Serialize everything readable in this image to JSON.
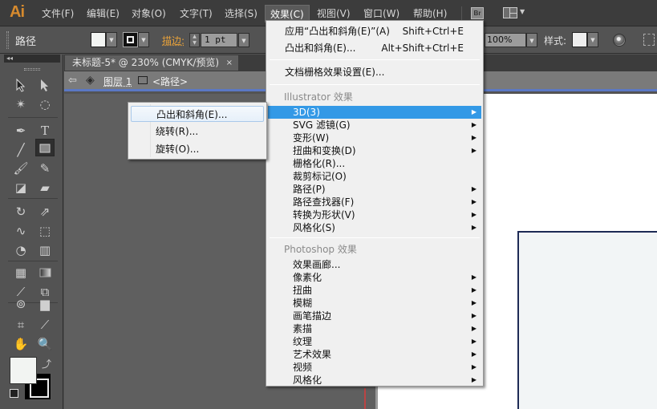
{
  "app": {
    "logo": "Ai"
  },
  "menubar": {
    "items": [
      "文件(F)",
      "编辑(E)",
      "对象(O)",
      "文字(T)",
      "选择(S)",
      "效果(C)",
      "视图(V)",
      "窗口(W)",
      "帮助(H)"
    ],
    "open_item": "效果(C)",
    "bridge_label": "Br"
  },
  "controlbar": {
    "selection_label": "路径",
    "stroke_label": "描边:",
    "stroke_weight": "1 pt",
    "opacity": "100%",
    "style_label": "样式:"
  },
  "document": {
    "tab_title": "未标题-5* @ 230% (CMYK/预览)",
    "tab_close": "×",
    "breadcrumb_layer": "图层 1",
    "breadcrumb_path": "<路径>"
  },
  "effect_menu": {
    "apply_last": {
      "label": "应用“凸出和斜角(E)”(A)",
      "shortcut": "Shift+Ctrl+E"
    },
    "last_effect": {
      "label": "凸出和斜角(E)...",
      "shortcut": "Alt+Shift+Ctrl+E"
    },
    "raster_settings": "文档栅格效果设置(E)...",
    "illustrator_header": "Illustrator 效果",
    "illustrator_items": [
      {
        "label": "3D(3)",
        "submenu": true,
        "highlighted": true
      },
      {
        "label": "SVG 滤镜(G)",
        "submenu": true
      },
      {
        "label": "变形(W)",
        "submenu": true
      },
      {
        "label": "扭曲和变换(D)",
        "submenu": true
      },
      {
        "label": "栅格化(R)...",
        "submenu": false
      },
      {
        "label": "裁剪标记(O)",
        "submenu": false
      },
      {
        "label": "路径(P)",
        "submenu": true
      },
      {
        "label": "路径查找器(F)",
        "submenu": true
      },
      {
        "label": "转换为形状(V)",
        "submenu": true
      },
      {
        "label": "风格化(S)",
        "submenu": true
      }
    ],
    "photoshop_header": "Photoshop 效果",
    "photoshop_items": [
      {
        "label": "效果画廊...",
        "submenu": false
      },
      {
        "label": "像素化",
        "submenu": true
      },
      {
        "label": "扭曲",
        "submenu": true
      },
      {
        "label": "模糊",
        "submenu": true
      },
      {
        "label": "画笔描边",
        "submenu": true
      },
      {
        "label": "素描",
        "submenu": true
      },
      {
        "label": "纹理",
        "submenu": true
      },
      {
        "label": "艺术效果",
        "submenu": true
      },
      {
        "label": "视频",
        "submenu": true
      },
      {
        "label": "风格化",
        "submenu": true
      }
    ]
  },
  "submenu_3d": {
    "items": [
      "凸出和斜角(E)...",
      "绕转(R)...",
      "旋转(O)..."
    ],
    "hovered": "凸出和斜角(E)..."
  },
  "tools_panel": {
    "collapse_label": "◂◂",
    "tools": [
      "selection-tool",
      "direct-selection-tool",
      "magic-wand-tool",
      "lasso-tool",
      "pen-tool",
      "type-tool",
      "line-tool",
      "rectangle-tool",
      "paintbrush-tool",
      "pencil-tool",
      "blob-brush-tool",
      "eraser-tool",
      "rotate-tool",
      "scale-tool",
      "warp-tool",
      "free-transform-tool",
      "shape-builder-tool",
      "perspective-grid-tool",
      "mesh-tool",
      "gradient-tool",
      "eyedropper-tool",
      "blend-tool",
      "symbol-sprayer-tool",
      "column-graph-tool",
      "artboard-tool",
      "slice-tool",
      "hand-tool",
      "zoom-tool"
    ],
    "active_tool": "rectangle-tool"
  },
  "colors": {
    "accent_highlight": "#3399e6",
    "stroke_label": "#e8a23a",
    "logo": "#d68a2e",
    "fill": "#f2f4f2",
    "stroke": "#000000"
  }
}
